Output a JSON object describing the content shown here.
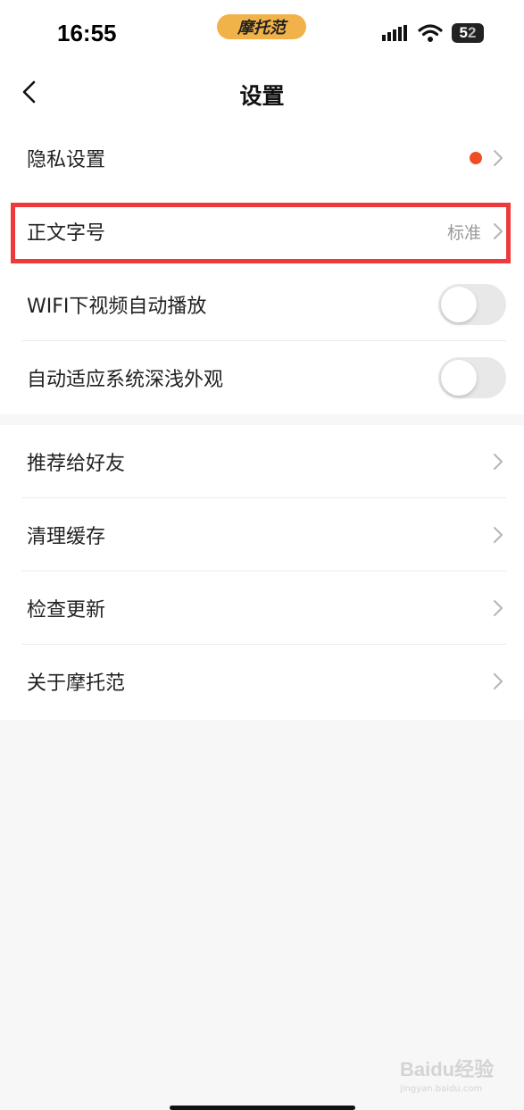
{
  "status_bar": {
    "time": "16:55",
    "app_badge": "摩托范",
    "battery": "52",
    "icons": [
      "signal-icon",
      "wifi-icon",
      "battery-icon"
    ]
  },
  "nav": {
    "title": "设置",
    "back_icon": "chevron-left-icon"
  },
  "group1": {
    "privacy": {
      "label": "隐私设置",
      "indicator_color": "#ee4e23"
    },
    "font_size": {
      "label": "正文字号",
      "value": "标准"
    },
    "wifi_autoplay": {
      "label": "WIFI下视频自动播放",
      "enabled": false
    },
    "auto_appearance": {
      "label": "自动适应系统深浅外观",
      "enabled": false
    }
  },
  "group2": {
    "items": [
      {
        "label": "推荐给好友"
      },
      {
        "label": "清理缓存"
      },
      {
        "label": "检查更新"
      },
      {
        "label": "关于摩托范"
      }
    ]
  },
  "highlight_color": "#ee3a3a",
  "watermark": {
    "main": "Baidu经验",
    "sub": "jingyan.baidu.com"
  }
}
